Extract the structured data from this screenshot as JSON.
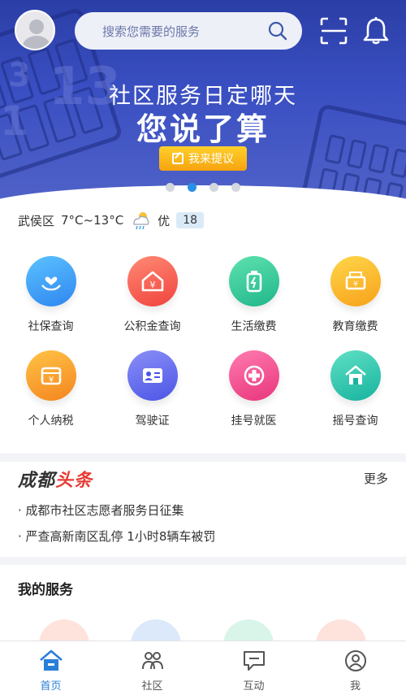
{
  "header": {
    "search_placeholder": "搜索您需要的服务"
  },
  "banner": {
    "line1": "社区服务日定哪天",
    "line2": "您说了算",
    "button_label": "我来提议",
    "page_count": 4,
    "active_page": 2
  },
  "weather": {
    "district": "武侯区",
    "temperature": "7°C~13°C",
    "condition_icon": "cloud-rain-sun-icon",
    "air_quality": "优",
    "aqi": "18"
  },
  "services": [
    {
      "label": "社保查询",
      "icon": "heart-hand-icon",
      "colors": [
        "#5bc2ff",
        "#2f86f0"
      ]
    },
    {
      "label": "公积金查询",
      "icon": "house-yen-icon",
      "colors": [
        "#ff8a75",
        "#f0433d"
      ]
    },
    {
      "label": "生活缴费",
      "icon": "bottle-bolt-icon",
      "colors": [
        "#5fe2b0",
        "#1fb68a"
      ]
    },
    {
      "label": "教育缴费",
      "icon": "mailbox-yen-icon",
      "colors": [
        "#ffd64a",
        "#f7a21a"
      ]
    },
    {
      "label": "个人纳税",
      "icon": "wallet-yen-icon",
      "colors": [
        "#ffc346",
        "#f4851f"
      ]
    },
    {
      "label": "驾驶证",
      "icon": "id-card-icon",
      "colors": [
        "#8b8ff7",
        "#4b55e5"
      ]
    },
    {
      "label": "挂号就医",
      "icon": "medical-cross-icon",
      "colors": [
        "#ff7bb0",
        "#e8357b"
      ]
    },
    {
      "label": "摇号查询",
      "icon": "home-icon",
      "colors": [
        "#5fe0c5",
        "#17b39e"
      ]
    }
  ],
  "headlines": {
    "logo_part1": "成都",
    "logo_part2": "头条",
    "more_label": "更多",
    "items": [
      "· 成都市社区志愿者服务日征集",
      "· 严查高新南区乱停 1小时8辆车被罚"
    ]
  },
  "my_services": {
    "title": "我的服务"
  },
  "tabbar": {
    "items": [
      {
        "label": "首页",
        "icon": "home-icon",
        "active": true
      },
      {
        "label": "社区",
        "icon": "community-icon",
        "active": false
      },
      {
        "label": "互动",
        "icon": "chat-icon",
        "active": false
      },
      {
        "label": "我",
        "icon": "profile-icon",
        "active": false
      }
    ]
  },
  "colors": {
    "accent": "#2a7fd9",
    "banner": "#3a4fc2",
    "button": "#f6a30e",
    "brand_red": "#e53c34"
  }
}
